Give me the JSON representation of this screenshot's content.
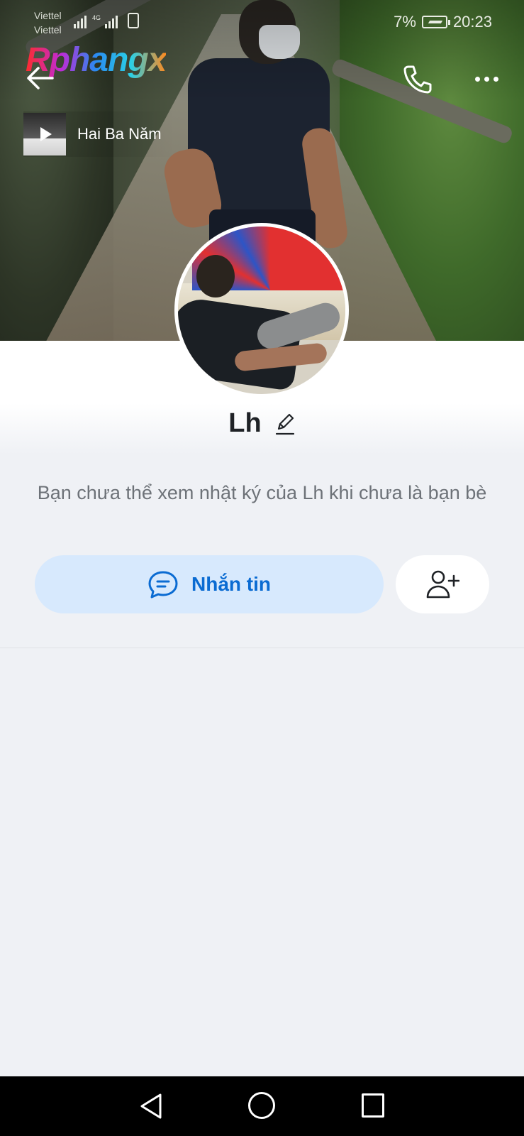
{
  "status_bar": {
    "carrier_1": "Viettel",
    "carrier_2": "Viettel",
    "network_type": "4G",
    "battery": "7%",
    "time": "20:23"
  },
  "watermark": "Rphangx",
  "header": {
    "back_icon": "arrow-left-icon",
    "call_icon": "phone-icon",
    "more_icon": "more-horizontal-icon"
  },
  "music": {
    "title": "Hai Ba Năm",
    "icon": "play-icon"
  },
  "profile": {
    "name": "Lh",
    "edit_icon": "pencil-icon"
  },
  "notice": "Bạn chưa thể xem nhật ký của Lh khi chưa là bạn bè",
  "actions": {
    "message_label": "Nhắn tin",
    "message_icon": "chat-bubble-icon",
    "add_friend_icon": "add-user-icon"
  },
  "colors": {
    "accent": "#0a6bd2",
    "message_button_bg": "#d7e9fd",
    "page_bg": "#eff1f5"
  }
}
